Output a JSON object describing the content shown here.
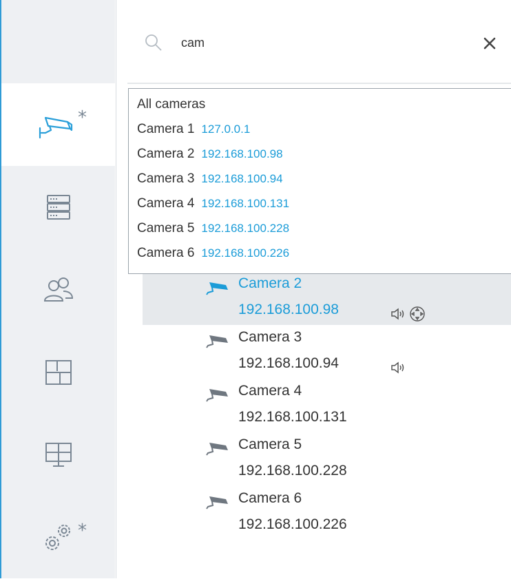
{
  "search": {
    "value": "cam",
    "placeholder": ""
  },
  "dropdown": {
    "all_label": "All cameras",
    "items": [
      {
        "name": "Camera 1",
        "ip": "127.0.0.1"
      },
      {
        "name": "Camera 2",
        "ip": "192.168.100.98"
      },
      {
        "name": "Camera 3",
        "ip": "192.168.100.94"
      },
      {
        "name": "Camera 4",
        "ip": "192.168.100.131"
      },
      {
        "name": "Camera 5",
        "ip": "192.168.100.228"
      },
      {
        "name": "Camera 6",
        "ip": "192.168.100.226"
      }
    ]
  },
  "sidebar": {
    "items": [
      {
        "icon": "camera-icon",
        "badge": "*",
        "active": true
      },
      {
        "icon": "server-icon"
      },
      {
        "icon": "users-icon"
      },
      {
        "icon": "layout-icon"
      },
      {
        "icon": "monitor-icon"
      },
      {
        "icon": "settings-icon",
        "badge": "*"
      }
    ]
  },
  "tree": [
    {
      "name": "Camera 2",
      "ip": "192.168.100.98",
      "selected": true,
      "audio": true,
      "ptz": true
    },
    {
      "name": "Camera 3",
      "ip": "192.168.100.94",
      "audio": true
    },
    {
      "name": "Camera 4",
      "ip": "192.168.100.131"
    },
    {
      "name": "Camera 5",
      "ip": "192.168.100.228"
    },
    {
      "name": "Camera 6",
      "ip": "192.168.100.226"
    }
  ],
  "colors": {
    "accent": "#1b9cd8",
    "sidebar_bg": "#eef0f3",
    "selected_row": "#e6e9ec",
    "icon_gray": "#7a8794"
  }
}
